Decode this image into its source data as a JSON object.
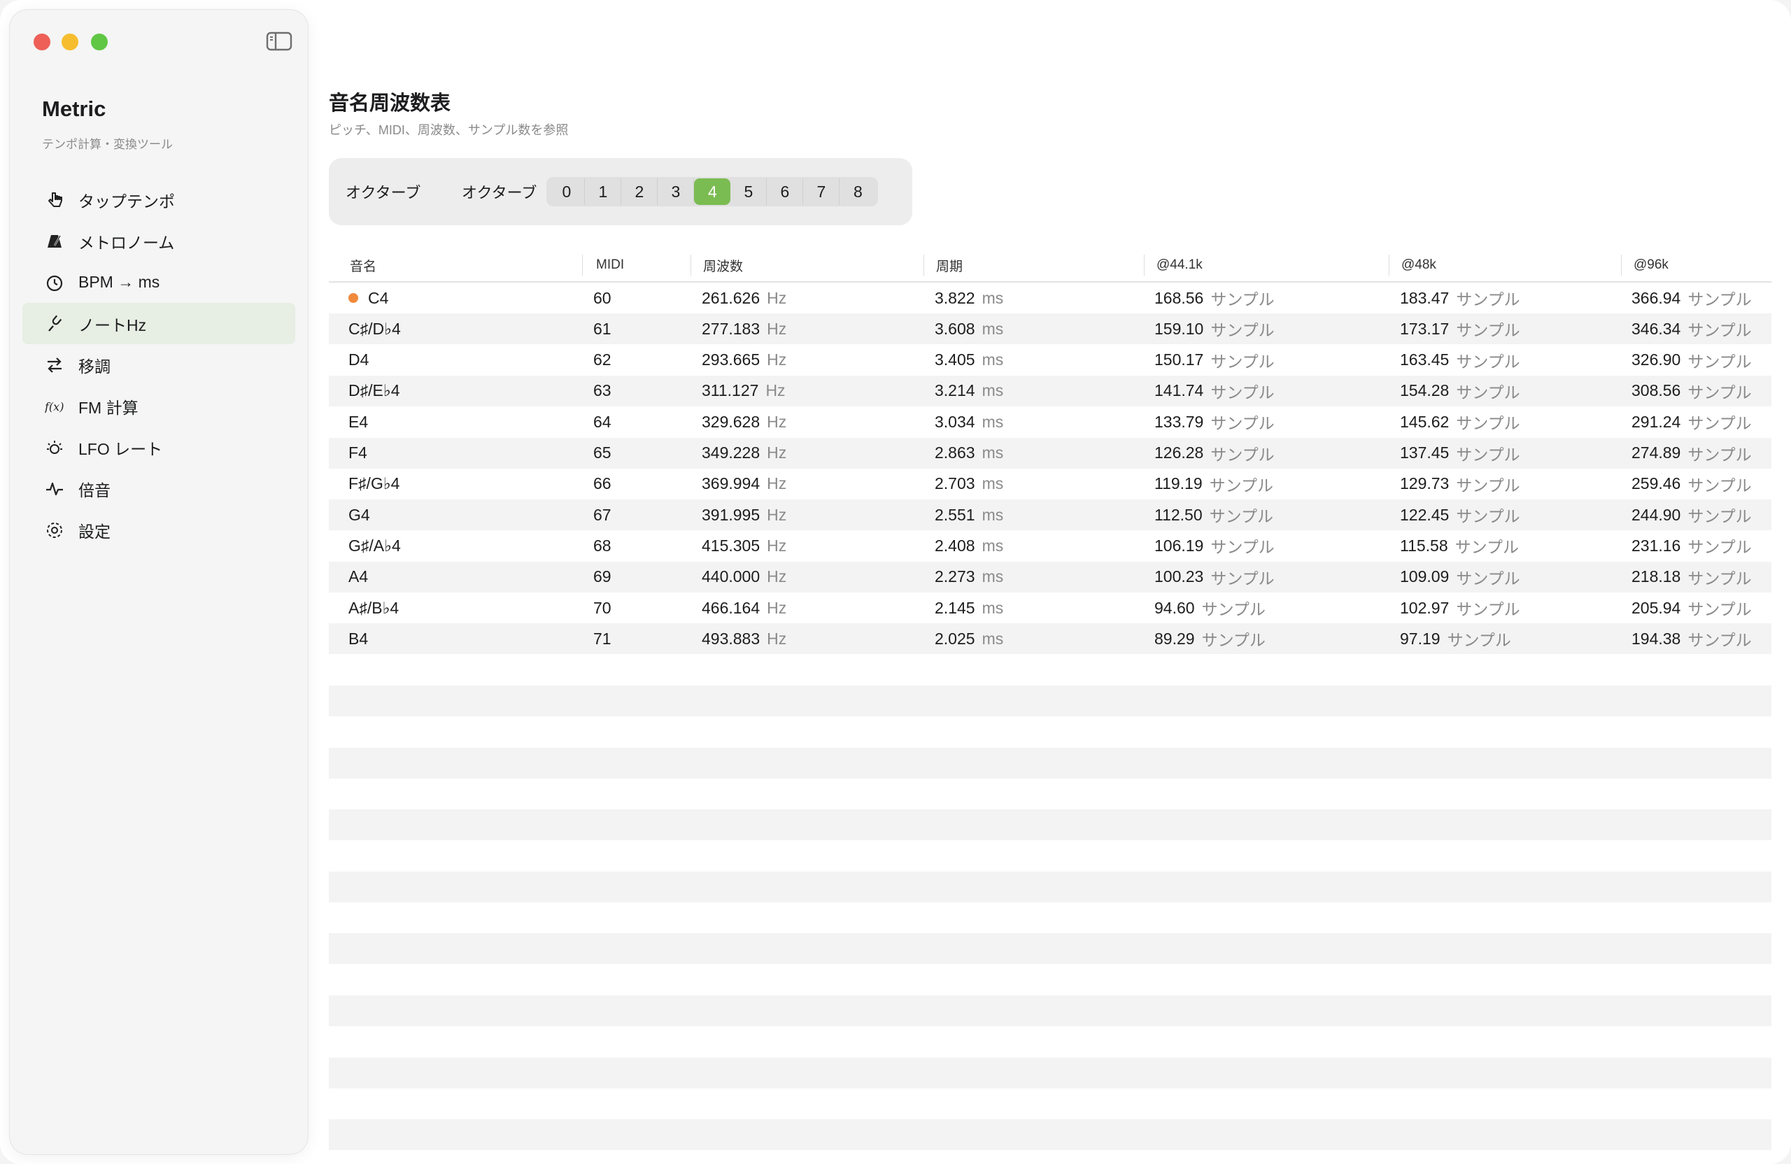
{
  "app": {
    "title": "Metric",
    "subtitle": "テンポ計算・変換ツール"
  },
  "sidebar": {
    "items": [
      {
        "label": "タップテンポ",
        "icon": "hand-tap-icon"
      },
      {
        "label": "メトロノーム",
        "icon": "metronome-icon"
      },
      {
        "label": "BPM → ms",
        "icon": "timer-icon"
      },
      {
        "label": "ノートHz",
        "icon": "tuning-fork-icon",
        "active": true
      },
      {
        "label": "移調",
        "icon": "arrows-swap-icon"
      },
      {
        "label": "FM 計算",
        "icon": "function-icon"
      },
      {
        "label": "LFO レート",
        "icon": "sun-dial-icon"
      },
      {
        "label": "倍音",
        "icon": "waveform-icon"
      },
      {
        "label": "設定",
        "icon": "gear-icon"
      }
    ]
  },
  "page": {
    "title": "音名周波数表",
    "subtitle": "ピッチ、MIDI、周波数、サンプル数を参照"
  },
  "octave": {
    "label": "オクターブ",
    "picker_label": "オクターブ",
    "options": [
      "0",
      "1",
      "2",
      "3",
      "4",
      "5",
      "6",
      "7",
      "8"
    ],
    "selected": "4"
  },
  "table": {
    "headers": [
      "音名",
      "MIDI",
      "周波数",
      "周期",
      "@44.1k",
      "@48k",
      "@96k"
    ],
    "units": {
      "freq": "Hz",
      "period": "ms",
      "samples": "サンプル"
    },
    "rows": [
      {
        "note": "C4",
        "midi": "60",
        "freq": "261.626",
        "period": "3.822",
        "s441": "168.56",
        "s48": "183.47",
        "s96": "366.94",
        "current": true
      },
      {
        "note": "C♯/D♭4",
        "midi": "61",
        "freq": "277.183",
        "period": "3.608",
        "s441": "159.10",
        "s48": "173.17",
        "s96": "346.34"
      },
      {
        "note": "D4",
        "midi": "62",
        "freq": "293.665",
        "period": "3.405",
        "s441": "150.17",
        "s48": "163.45",
        "s96": "326.90"
      },
      {
        "note": "D♯/E♭4",
        "midi": "63",
        "freq": "311.127",
        "period": "3.214",
        "s441": "141.74",
        "s48": "154.28",
        "s96": "308.56"
      },
      {
        "note": "E4",
        "midi": "64",
        "freq": "329.628",
        "period": "3.034",
        "s441": "133.79",
        "s48": "145.62",
        "s96": "291.24"
      },
      {
        "note": "F4",
        "midi": "65",
        "freq": "349.228",
        "period": "2.863",
        "s441": "126.28",
        "s48": "137.45",
        "s96": "274.89"
      },
      {
        "note": "F♯/G♭4",
        "midi": "66",
        "freq": "369.994",
        "period": "2.703",
        "s441": "119.19",
        "s48": "129.73",
        "s96": "259.46"
      },
      {
        "note": "G4",
        "midi": "67",
        "freq": "391.995",
        "period": "2.551",
        "s441": "112.50",
        "s48": "122.45",
        "s96": "244.90"
      },
      {
        "note": "G♯/A♭4",
        "midi": "68",
        "freq": "415.305",
        "period": "2.408",
        "s441": "106.19",
        "s48": "115.58",
        "s96": "231.16"
      },
      {
        "note": "A4",
        "midi": "69",
        "freq": "440.000",
        "period": "2.273",
        "s441": "100.23",
        "s48": "109.09",
        "s96": "218.18"
      },
      {
        "note": "A♯/B♭4",
        "midi": "70",
        "freq": "466.164",
        "period": "2.145",
        "s441": "94.60",
        "s48": "102.97",
        "s96": "205.94"
      },
      {
        "note": "B4",
        "midi": "71",
        "freq": "493.883",
        "period": "2.025",
        "s441": "89.29",
        "s48": "97.19",
        "s96": "194.38"
      }
    ]
  },
  "colors": {
    "accent": "#7bbc52",
    "current_dot": "#f08a3c",
    "active_nav": "#e7eee3"
  }
}
